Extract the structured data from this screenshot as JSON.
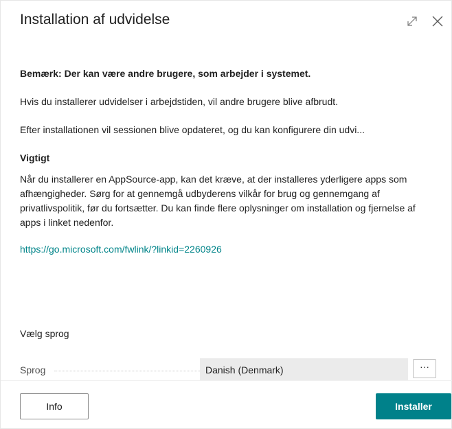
{
  "dialog": {
    "title": "Installation af udvidelse",
    "expand_icon": "expand-icon",
    "close_icon": "close-icon"
  },
  "content": {
    "warning": "Bemærk: Der kan være andre brugere, som arbejder i systemet.",
    "para1": "Hvis du installerer udvidelser i arbejdstiden, vil andre brugere blive afbrudt.",
    "para2": "Efter installationen vil sessionen blive opdateret, og du kan konfigurere din udvi...",
    "important_heading": "Vigtigt",
    "important_body": "Når du installerer en AppSource-app, kan det kræve, at der installeres yderligere apps som afhængigheder. Sørg for at gennemgå udbyderens vilkår for brug og gennemgang af privatlivspolitik, før du fortsætter. Du kan finde flere oplysninger om installation og fjernelse af apps i linket nedenfor.",
    "link": "https://go.microsoft.com/fwlink/?linkid=2260926"
  },
  "language": {
    "heading": "Vælg sprog",
    "field_label": "Sprog",
    "field_value": "Danish (Denmark)",
    "lookup_label": "···"
  },
  "footer": {
    "info_label": "Info",
    "install_label": "Installer"
  },
  "colors": {
    "accent": "#00818a",
    "link": "#008489"
  }
}
